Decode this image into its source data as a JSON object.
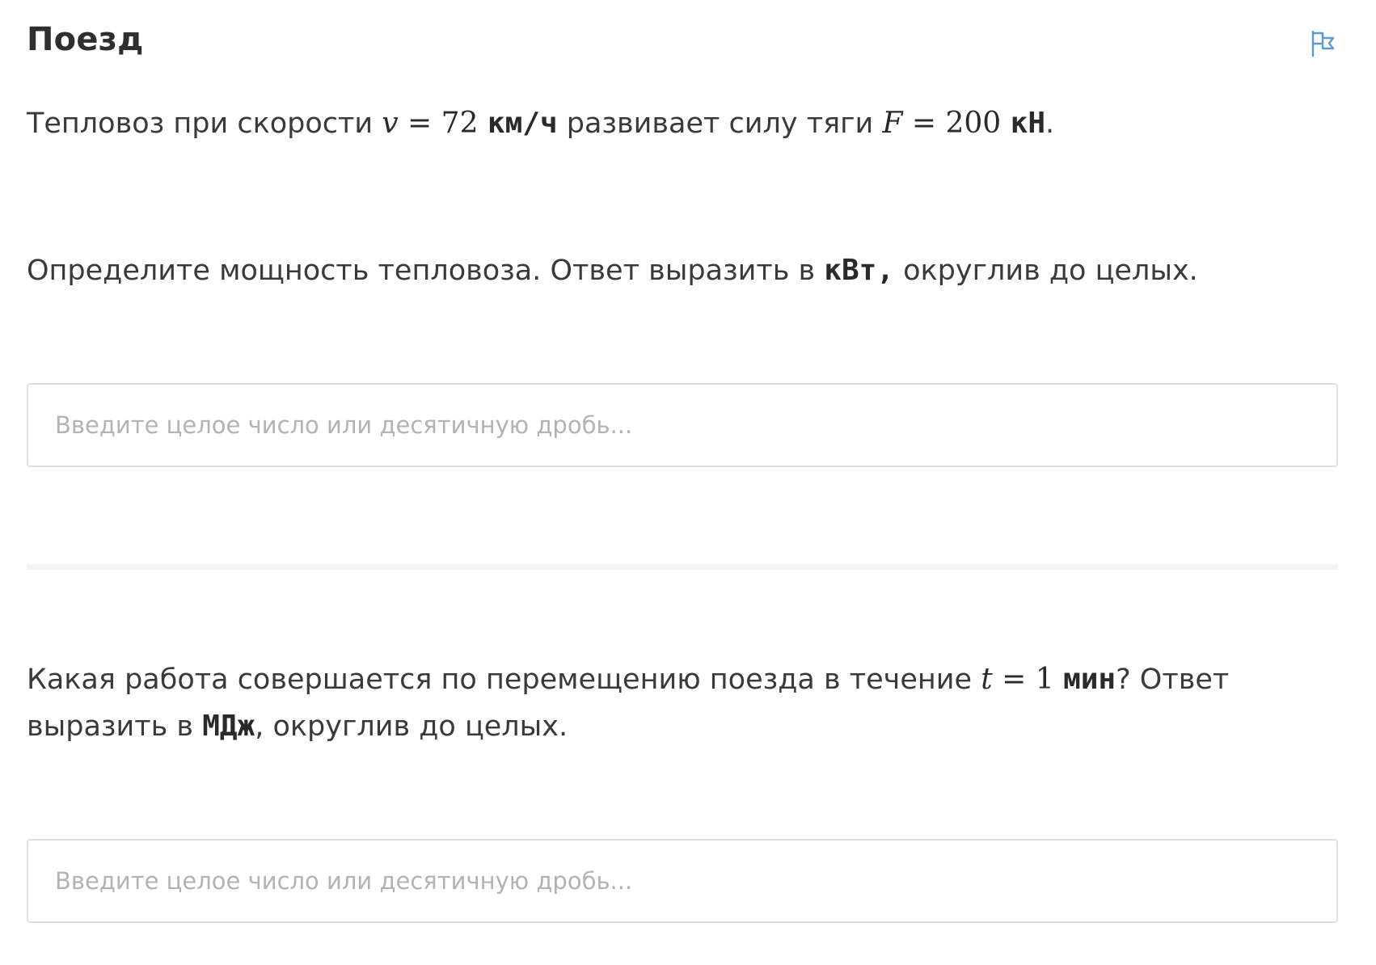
{
  "header": {
    "title": "Поезд",
    "flag_icon": "flag-icon",
    "accent_color": "#5b9bd5"
  },
  "intro": {
    "text_before": "Тепловоз при скорости ",
    "v_var": "v",
    "v_eq": " = 72 ",
    "v_unit": "км/ч",
    "text_middle": " развивает силу тяги ",
    "f_var": "F",
    "f_eq": " = 200 ",
    "f_unit": "кН",
    "text_end": "."
  },
  "question1": {
    "text_before": "Определите мощность тепловоза. Ответ выразить в ",
    "unit": "кВт,",
    "text_after": " округлив до целых.",
    "input_placeholder": "Введите целое число или десятичную дробь...",
    "input_value": ""
  },
  "question2": {
    "text_before": "Какая работа совершается по перемещению поезда в течение ",
    "t_var": "t",
    "t_eq": " = 1 ",
    "t_unit": "мин",
    "text_middle": "? Ответ выразить в ",
    "unit": "МДж",
    "text_after": ", округлив до целых.",
    "input_placeholder": "Введите целое число или десятичную дробь...",
    "input_value": ""
  }
}
